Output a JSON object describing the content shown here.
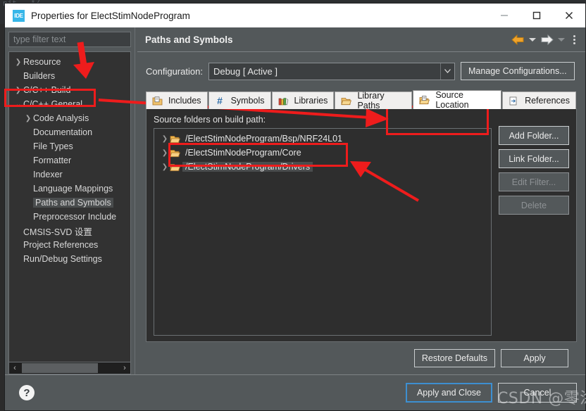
{
  "background": {
    "code_snippet": "nit   */"
  },
  "window": {
    "icon_label": "IDE",
    "title": "Properties for ElectStimNodeProgram",
    "controls": [
      {
        "name": "minimize",
        "glyph": "minimize-icon"
      },
      {
        "name": "maximize",
        "glyph": "maximize-icon"
      },
      {
        "name": "close",
        "glyph": "close-icon"
      }
    ]
  },
  "sidebar": {
    "filter_placeholder": "type filter text",
    "items": [
      {
        "label": "Resource",
        "twisty": "collapsed",
        "indent": 1,
        "selected": false
      },
      {
        "label": "Builders",
        "twisty": "none",
        "indent": 1,
        "selected": false
      },
      {
        "label": "C/C++ Build",
        "twisty": "collapsed",
        "indent": 1,
        "selected": false
      },
      {
        "label": "C/C++ General",
        "twisty": "expanded",
        "indent": 1,
        "selected": false
      },
      {
        "label": "Code Analysis",
        "twisty": "collapsed",
        "indent": 2,
        "selected": false
      },
      {
        "label": "Documentation",
        "twisty": "none",
        "indent": 2,
        "selected": false
      },
      {
        "label": "File Types",
        "twisty": "none",
        "indent": 2,
        "selected": false
      },
      {
        "label": "Formatter",
        "twisty": "none",
        "indent": 2,
        "selected": false
      },
      {
        "label": "Indexer",
        "twisty": "none",
        "indent": 2,
        "selected": false
      },
      {
        "label": "Language Mappings",
        "twisty": "none",
        "indent": 2,
        "selected": false
      },
      {
        "label": "Paths and Symbols",
        "twisty": "none",
        "indent": 2,
        "selected": true
      },
      {
        "label": "Preprocessor Include",
        "twisty": "none",
        "indent": 2,
        "selected": false
      },
      {
        "label": "CMSIS-SVD 设置",
        "twisty": "none",
        "indent": 1,
        "selected": false
      },
      {
        "label": "Project References",
        "twisty": "none",
        "indent": 1,
        "selected": false
      },
      {
        "label": "Run/Debug Settings",
        "twisty": "none",
        "indent": 1,
        "selected": false
      }
    ],
    "scrollbar": {
      "left_arrow": "‹",
      "right_arrow": "›"
    }
  },
  "page": {
    "title": "Paths and Symbols",
    "toolbar": {
      "back_icon": "back-arrow-icon",
      "back_menu_icon": "chevron-down-icon",
      "forward_icon": "forward-arrow-icon",
      "forward_menu_icon": "chevron-down-icon",
      "menu_icon": "vertical-dots-icon"
    },
    "configuration": {
      "label": "Configuration:",
      "value": "Debug  [ Active ]",
      "dropdown_icon": "chevron-down-icon",
      "manage_button": "Manage Configurations..."
    },
    "tabs": [
      {
        "label": "Includes",
        "icon": "includes-icon",
        "active": false
      },
      {
        "label": "Symbols",
        "icon": "hash-icon",
        "active": false
      },
      {
        "label": "Libraries",
        "icon": "libraries-icon",
        "active": false
      },
      {
        "label": "Library Paths",
        "icon": "library-paths-icon",
        "active": false
      },
      {
        "label": "Source Location",
        "icon": "source-location-icon",
        "active": true
      },
      {
        "label": "References",
        "icon": "references-icon",
        "active": false
      }
    ],
    "source_location": {
      "caption": "Source folders on build path:",
      "folders": [
        {
          "path": "/ElectStimNodeProgram/Bsp/NRF24L01",
          "icon": "folder-filtered-icon",
          "selected": false
        },
        {
          "path": "/ElectStimNodeProgram/Core",
          "icon": "folder-icon",
          "selected": false
        },
        {
          "path": "/ElectStimNodeProgram/Drivers",
          "icon": "folder-icon",
          "selected": true
        }
      ],
      "buttons": [
        {
          "label": "Add Folder...",
          "enabled": true
        },
        {
          "label": "Link Folder...",
          "enabled": true
        },
        {
          "label": "Edit Filter...",
          "enabled": false
        },
        {
          "label": "Delete",
          "enabled": false
        }
      ]
    },
    "page_buttons": [
      {
        "label": "Restore Defaults",
        "enabled": true
      },
      {
        "label": "Apply",
        "enabled": true
      }
    ]
  },
  "dialog_footer": {
    "help_icon": "help-icon",
    "buttons": [
      {
        "label": "Apply and Close",
        "default": true
      },
      {
        "label": "Cancel",
        "default": false
      }
    ]
  },
  "watermark": {
    "text": "CSDN @零涂"
  },
  "colors": {
    "panel_bg": "#53585a",
    "list_bg": "#2e2e2e",
    "tree_bg": "#323232",
    "accent_blue": "#3d8fd1",
    "annotation_red": "#ee1c1c",
    "title_bar": "#ffffff",
    "folder_yellow": "#f0b64a"
  }
}
